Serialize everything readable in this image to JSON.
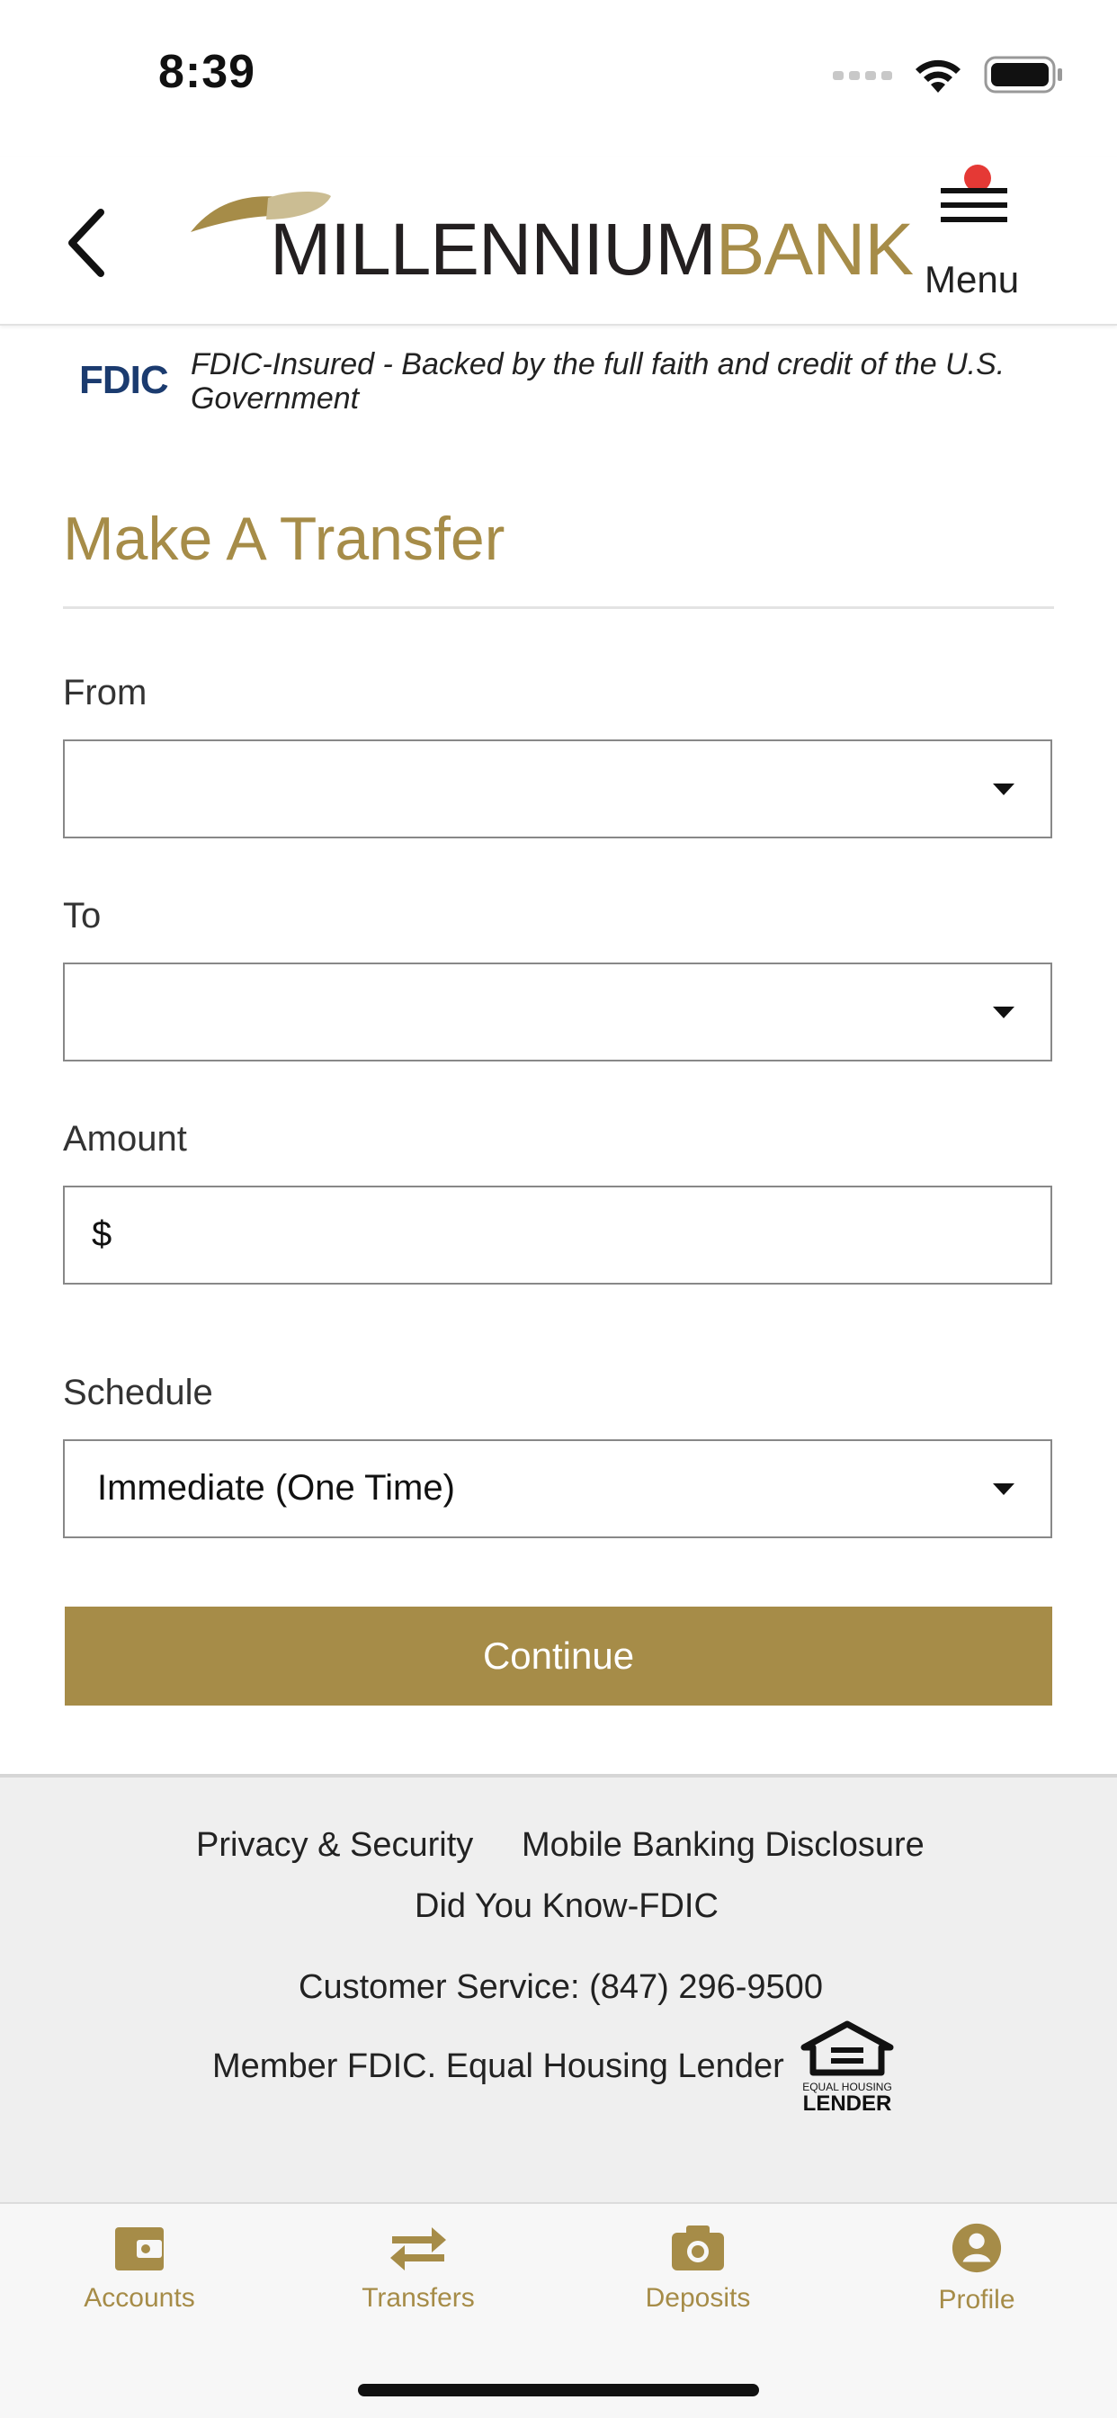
{
  "status_bar": {
    "time": "8:39"
  },
  "header": {
    "logo_dark": "MILLENNIUM",
    "logo_gold": "BANK",
    "menu_label": "Menu"
  },
  "fdic": {
    "logo": "FDIC",
    "text": "FDIC-Insured - Backed by the full faith and credit of the U.S. Government"
  },
  "form": {
    "title": "Make A Transfer",
    "from_label": "From",
    "from_value": "",
    "to_label": "To",
    "to_value": "",
    "amount_label": "Amount",
    "currency_symbol": "$",
    "amount_value": "",
    "schedule_label": "Schedule",
    "schedule_value": "Immediate (One Time)",
    "continue_label": "Continue"
  },
  "footer": {
    "privacy_link": "Privacy & Security",
    "disclosure_link": "Mobile Banking Disclosure",
    "fdic_link": "Did You Know-FDIC",
    "customer_service": "Customer Service: (847) 296-9500",
    "member_text": "Member FDIC. Equal Housing Lender",
    "ehl_top": "EQUAL HOUSING",
    "ehl_bottom": "LENDER"
  },
  "tabs": [
    {
      "label": "Accounts",
      "icon": "wallet-icon"
    },
    {
      "label": "Transfers",
      "icon": "swap-arrows-icon"
    },
    {
      "label": "Deposits",
      "icon": "camera-icon"
    },
    {
      "label": "Profile",
      "icon": "user-circle-icon"
    }
  ],
  "colors": {
    "brand_gold": "#a68c48",
    "brand_dark": "#231f20",
    "fdic_blue": "#1b3b6f",
    "notification_red": "#e53935"
  }
}
